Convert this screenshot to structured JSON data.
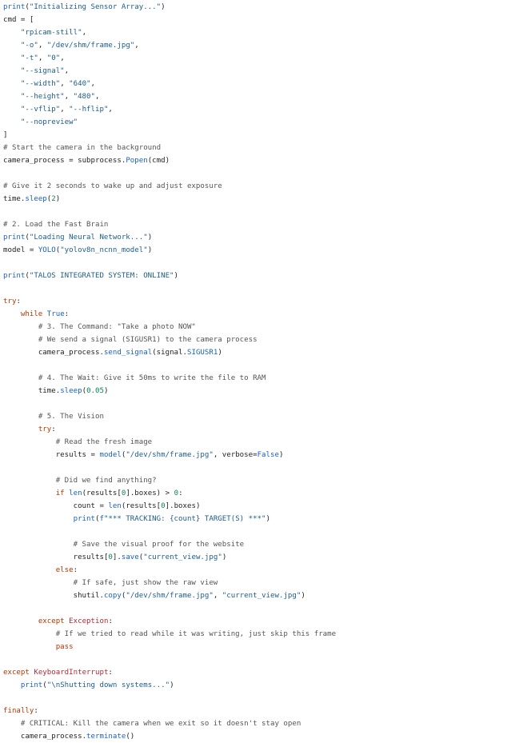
{
  "code": {
    "lines": [
      [
        [
          "fn",
          "print"
        ],
        [
          "op",
          "("
        ],
        [
          "str",
          "\"Initializing Sensor Array...\""
        ],
        [
          "op",
          ")"
        ]
      ],
      [
        [
          "id",
          "cmd"
        ],
        [
          "op",
          " = ["
        ]
      ],
      [
        [
          "op",
          "    "
        ],
        [
          "str",
          "\"rpicam-still\""
        ],
        [
          "op",
          ","
        ]
      ],
      [
        [
          "op",
          "    "
        ],
        [
          "str",
          "\"-o\""
        ],
        [
          "op",
          ", "
        ],
        [
          "str",
          "\"/dev/shm/frame.jpg\""
        ],
        [
          "op",
          ","
        ]
      ],
      [
        [
          "op",
          "    "
        ],
        [
          "str",
          "\"-t\""
        ],
        [
          "op",
          ", "
        ],
        [
          "str",
          "\"0\""
        ],
        [
          "op",
          ","
        ]
      ],
      [
        [
          "op",
          "    "
        ],
        [
          "str",
          "\"--signal\""
        ],
        [
          "op",
          ","
        ]
      ],
      [
        [
          "op",
          "    "
        ],
        [
          "str",
          "\"--width\""
        ],
        [
          "op",
          ", "
        ],
        [
          "str",
          "\"640\""
        ],
        [
          "op",
          ","
        ]
      ],
      [
        [
          "op",
          "    "
        ],
        [
          "str",
          "\"--height\""
        ],
        [
          "op",
          ", "
        ],
        [
          "str",
          "\"480\""
        ],
        [
          "op",
          ","
        ]
      ],
      [
        [
          "op",
          "    "
        ],
        [
          "str",
          "\"--vflip\""
        ],
        [
          "op",
          ", "
        ],
        [
          "str",
          "\"--hflip\""
        ],
        [
          "op",
          ","
        ]
      ],
      [
        [
          "op",
          "    "
        ],
        [
          "str",
          "\"--nopreview\""
        ]
      ],
      [
        [
          "op",
          "]"
        ]
      ],
      [
        [
          "com",
          "# Start the camera in the background"
        ]
      ],
      [
        [
          "id",
          "camera_process"
        ],
        [
          "op",
          " = "
        ],
        [
          "id",
          "subprocess"
        ],
        [
          "op",
          "."
        ],
        [
          "fn",
          "Popen"
        ],
        [
          "op",
          "(cmd)"
        ]
      ],
      [],
      [
        [
          "com",
          "# Give it 2 seconds to wake up and adjust exposure"
        ]
      ],
      [
        [
          "id",
          "time"
        ],
        [
          "op",
          "."
        ],
        [
          "fn",
          "sleep"
        ],
        [
          "op",
          "("
        ],
        [
          "num",
          "2"
        ],
        [
          "op",
          ")"
        ]
      ],
      [],
      [
        [
          "com",
          "# 2. Load the Fast Brain"
        ]
      ],
      [
        [
          "fn",
          "print"
        ],
        [
          "op",
          "("
        ],
        [
          "str",
          "\"Loading Neural Network...\""
        ],
        [
          "op",
          ")"
        ]
      ],
      [
        [
          "id",
          "model"
        ],
        [
          "op",
          " = "
        ],
        [
          "fn",
          "YOLO"
        ],
        [
          "op",
          "("
        ],
        [
          "str",
          "\"yolov8n_ncnn_model\""
        ],
        [
          "op",
          ")"
        ]
      ],
      [],
      [
        [
          "fn",
          "print"
        ],
        [
          "op",
          "("
        ],
        [
          "str",
          "\"TALOS INTEGRATED SYSTEM: ONLINE\""
        ],
        [
          "op",
          ")"
        ]
      ],
      [],
      [
        [
          "kw",
          "try"
        ],
        [
          "op",
          ":"
        ]
      ],
      [
        [
          "op",
          "    "
        ],
        [
          "kw",
          "while"
        ],
        [
          "op",
          " "
        ],
        [
          "const",
          "True"
        ],
        [
          "op",
          ":"
        ]
      ],
      [
        [
          "op",
          "        "
        ],
        [
          "com",
          "# 3. The Command: \"Take a photo NOW\""
        ]
      ],
      [
        [
          "op",
          "        "
        ],
        [
          "com",
          "# We send a signal (SIGUSR1) to the camera process"
        ]
      ],
      [
        [
          "op",
          "        "
        ],
        [
          "id",
          "camera_process"
        ],
        [
          "op",
          "."
        ],
        [
          "fn",
          "send_signal"
        ],
        [
          "op",
          "(signal."
        ],
        [
          "const",
          "SIGUSR1"
        ],
        [
          "op",
          ")"
        ]
      ],
      [],
      [
        [
          "op",
          "        "
        ],
        [
          "com",
          "# 4. The Wait: Give it 50ms to write the file to RAM"
        ]
      ],
      [
        [
          "op",
          "        "
        ],
        [
          "id",
          "time"
        ],
        [
          "op",
          "."
        ],
        [
          "fn",
          "sleep"
        ],
        [
          "op",
          "("
        ],
        [
          "num",
          "0.05"
        ],
        [
          "op",
          ")"
        ]
      ],
      [],
      [
        [
          "op",
          "        "
        ],
        [
          "com",
          "# 5. The Vision"
        ]
      ],
      [
        [
          "op",
          "        "
        ],
        [
          "kw",
          "try"
        ],
        [
          "op",
          ":"
        ]
      ],
      [
        [
          "op",
          "            "
        ],
        [
          "com",
          "# Read the fresh image"
        ]
      ],
      [
        [
          "op",
          "            "
        ],
        [
          "id",
          "results"
        ],
        [
          "op",
          " = "
        ],
        [
          "fn",
          "model"
        ],
        [
          "op",
          "("
        ],
        [
          "str",
          "\"/dev/shm/frame.jpg\""
        ],
        [
          "op",
          ", verbose="
        ],
        [
          "const",
          "False"
        ],
        [
          "op",
          ")"
        ]
      ],
      [],
      [
        [
          "op",
          "            "
        ],
        [
          "com",
          "# Did we find anything?"
        ]
      ],
      [
        [
          "op",
          "            "
        ],
        [
          "kw",
          "if"
        ],
        [
          "op",
          " "
        ],
        [
          "bi",
          "len"
        ],
        [
          "op",
          "(results["
        ],
        [
          "num",
          "0"
        ],
        [
          "op",
          "]."
        ],
        [
          "id",
          "boxes"
        ],
        [
          "op",
          ") > "
        ],
        [
          "num",
          "0"
        ],
        [
          "op",
          ":"
        ]
      ],
      [
        [
          "op",
          "                "
        ],
        [
          "id",
          "count"
        ],
        [
          "op",
          " = "
        ],
        [
          "bi",
          "len"
        ],
        [
          "op",
          "(results["
        ],
        [
          "num",
          "0"
        ],
        [
          "op",
          "]."
        ],
        [
          "id",
          "boxes"
        ],
        [
          "op",
          ")"
        ]
      ],
      [
        [
          "op",
          "                "
        ],
        [
          "fn",
          "print"
        ],
        [
          "op",
          "("
        ],
        [
          "str",
          "f\"*** TRACKING: {count} TARGET(S) ***\""
        ],
        [
          "op",
          ")"
        ]
      ],
      [],
      [
        [
          "op",
          "                "
        ],
        [
          "com",
          "# Save the visual proof for the website"
        ]
      ],
      [
        [
          "op",
          "                "
        ],
        [
          "id",
          "results"
        ],
        [
          "op",
          "["
        ],
        [
          "num",
          "0"
        ],
        [
          "op",
          "]."
        ],
        [
          "fn",
          "save"
        ],
        [
          "op",
          "("
        ],
        [
          "str",
          "\"current_view.jpg\""
        ],
        [
          "op",
          ")"
        ]
      ],
      [
        [
          "op",
          "            "
        ],
        [
          "kw",
          "else"
        ],
        [
          "op",
          ":"
        ]
      ],
      [
        [
          "op",
          "                "
        ],
        [
          "com",
          "# If safe, just show the raw view"
        ]
      ],
      [
        [
          "op",
          "                "
        ],
        [
          "id",
          "shutil"
        ],
        [
          "op",
          "."
        ],
        [
          "fn",
          "copy"
        ],
        [
          "op",
          "("
        ],
        [
          "str",
          "\"/dev/shm/frame.jpg\""
        ],
        [
          "op",
          ", "
        ],
        [
          "str",
          "\"current_view.jpg\""
        ],
        [
          "op",
          ")"
        ]
      ],
      [],
      [
        [
          "op",
          "        "
        ],
        [
          "kw",
          "except"
        ],
        [
          "op",
          " "
        ],
        [
          "cls",
          "Exception"
        ],
        [
          "op",
          ":"
        ]
      ],
      [
        [
          "op",
          "            "
        ],
        [
          "com",
          "# If we tried to read while it was writing, just skip this frame"
        ]
      ],
      [
        [
          "op",
          "            "
        ],
        [
          "kw",
          "pass"
        ]
      ],
      [],
      [
        [
          "kw",
          "except"
        ],
        [
          "op",
          " "
        ],
        [
          "cls",
          "KeyboardInterrupt"
        ],
        [
          "op",
          ":"
        ]
      ],
      [
        [
          "op",
          "    "
        ],
        [
          "fn",
          "print"
        ],
        [
          "op",
          "("
        ],
        [
          "str",
          "\"\\nShutting down systems...\""
        ],
        [
          "op",
          ")"
        ]
      ],
      [],
      [
        [
          "kw",
          "finally"
        ],
        [
          "op",
          ":"
        ]
      ],
      [
        [
          "op",
          "    "
        ],
        [
          "com",
          "# CRITICAL: Kill the camera when we exit so it doesn't stay open"
        ]
      ],
      [
        [
          "op",
          "    "
        ],
        [
          "id",
          "camera_process"
        ],
        [
          "op",
          "."
        ],
        [
          "fn",
          "terminate"
        ],
        [
          "op",
          "()"
        ]
      ]
    ]
  }
}
